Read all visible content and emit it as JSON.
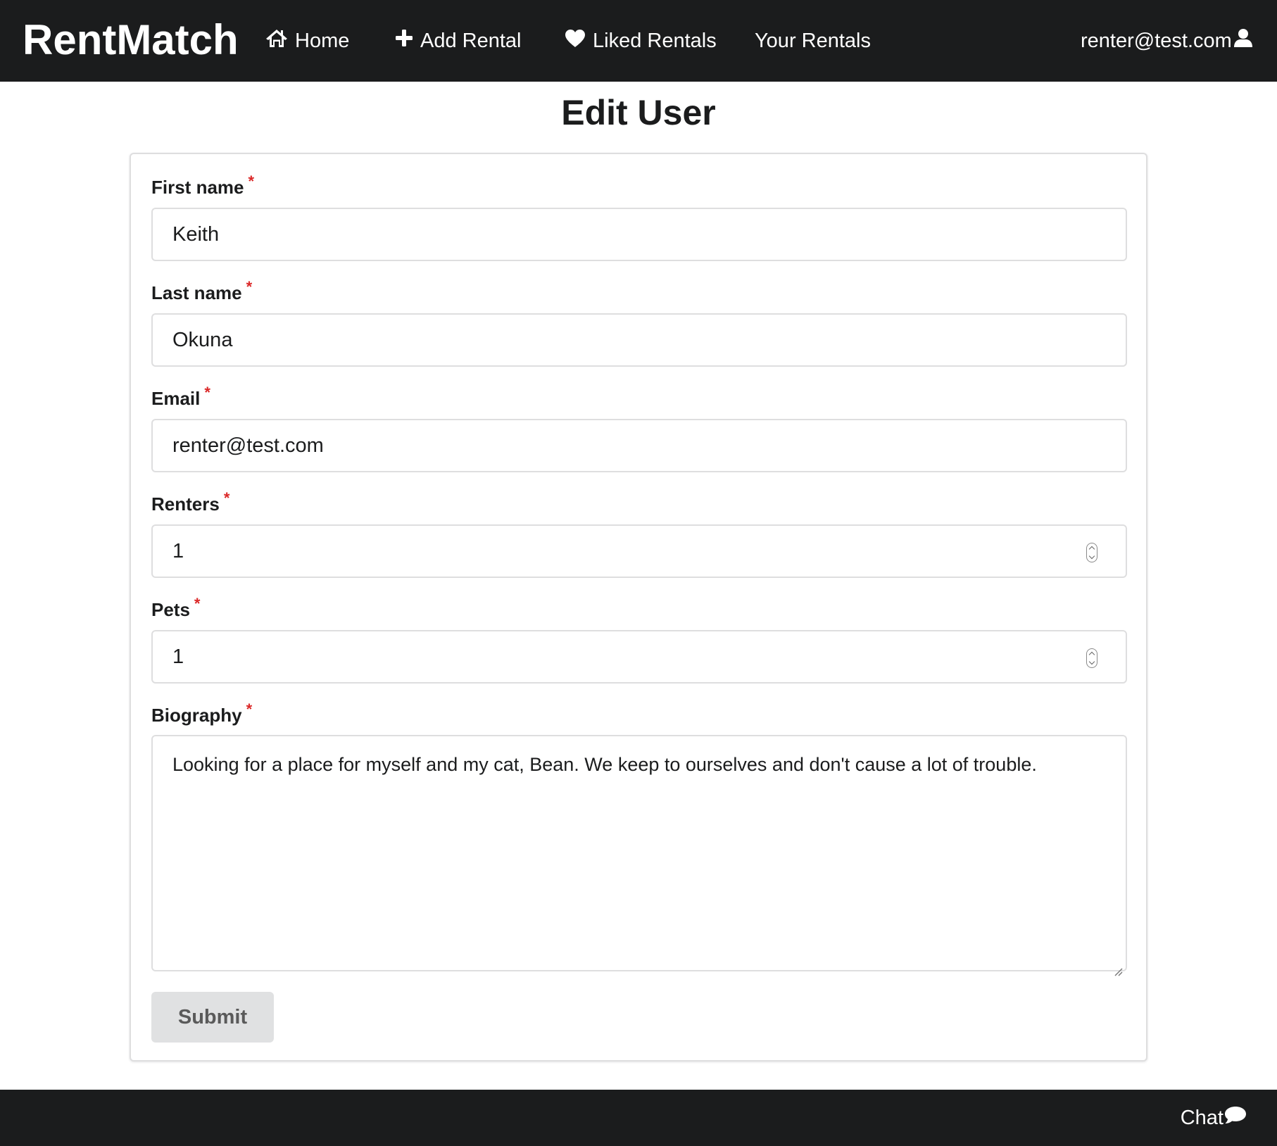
{
  "nav": {
    "brand": "RentMatch",
    "items": [
      {
        "label": "Home",
        "icon": "home-icon"
      },
      {
        "label": "Add Rental",
        "icon": "plus-icon"
      },
      {
        "label": "Liked Rentals",
        "icon": "heart-icon"
      },
      {
        "label": "Your Rentals",
        "icon": ""
      }
    ],
    "user_email": "renter@test.com",
    "user_icon": "user-icon"
  },
  "page": {
    "title": "Edit User"
  },
  "form": {
    "required_marker": "*",
    "fields": [
      {
        "label": "First name",
        "value": "Keith",
        "type": "text"
      },
      {
        "label": "Last name",
        "value": "Okuna",
        "type": "text"
      },
      {
        "label": "Email",
        "value": "renter@test.com",
        "type": "email"
      },
      {
        "label": "Renters",
        "value": "1",
        "type": "number"
      },
      {
        "label": "Pets",
        "value": "1",
        "type": "number"
      },
      {
        "label": "Biography",
        "value": "Looking for a place for myself and my cat, Bean. We keep to ourselves and don't cause a lot of trouble.",
        "type": "textarea"
      }
    ],
    "submit_label": "Submit"
  },
  "footer": {
    "chat_label": "Chat",
    "chat_icon": "comment-icon"
  },
  "colors": {
    "navbar_bg": "#1b1c1d",
    "required": "#db2828",
    "button_bg": "#e0e1e2",
    "border": "#dededf"
  }
}
